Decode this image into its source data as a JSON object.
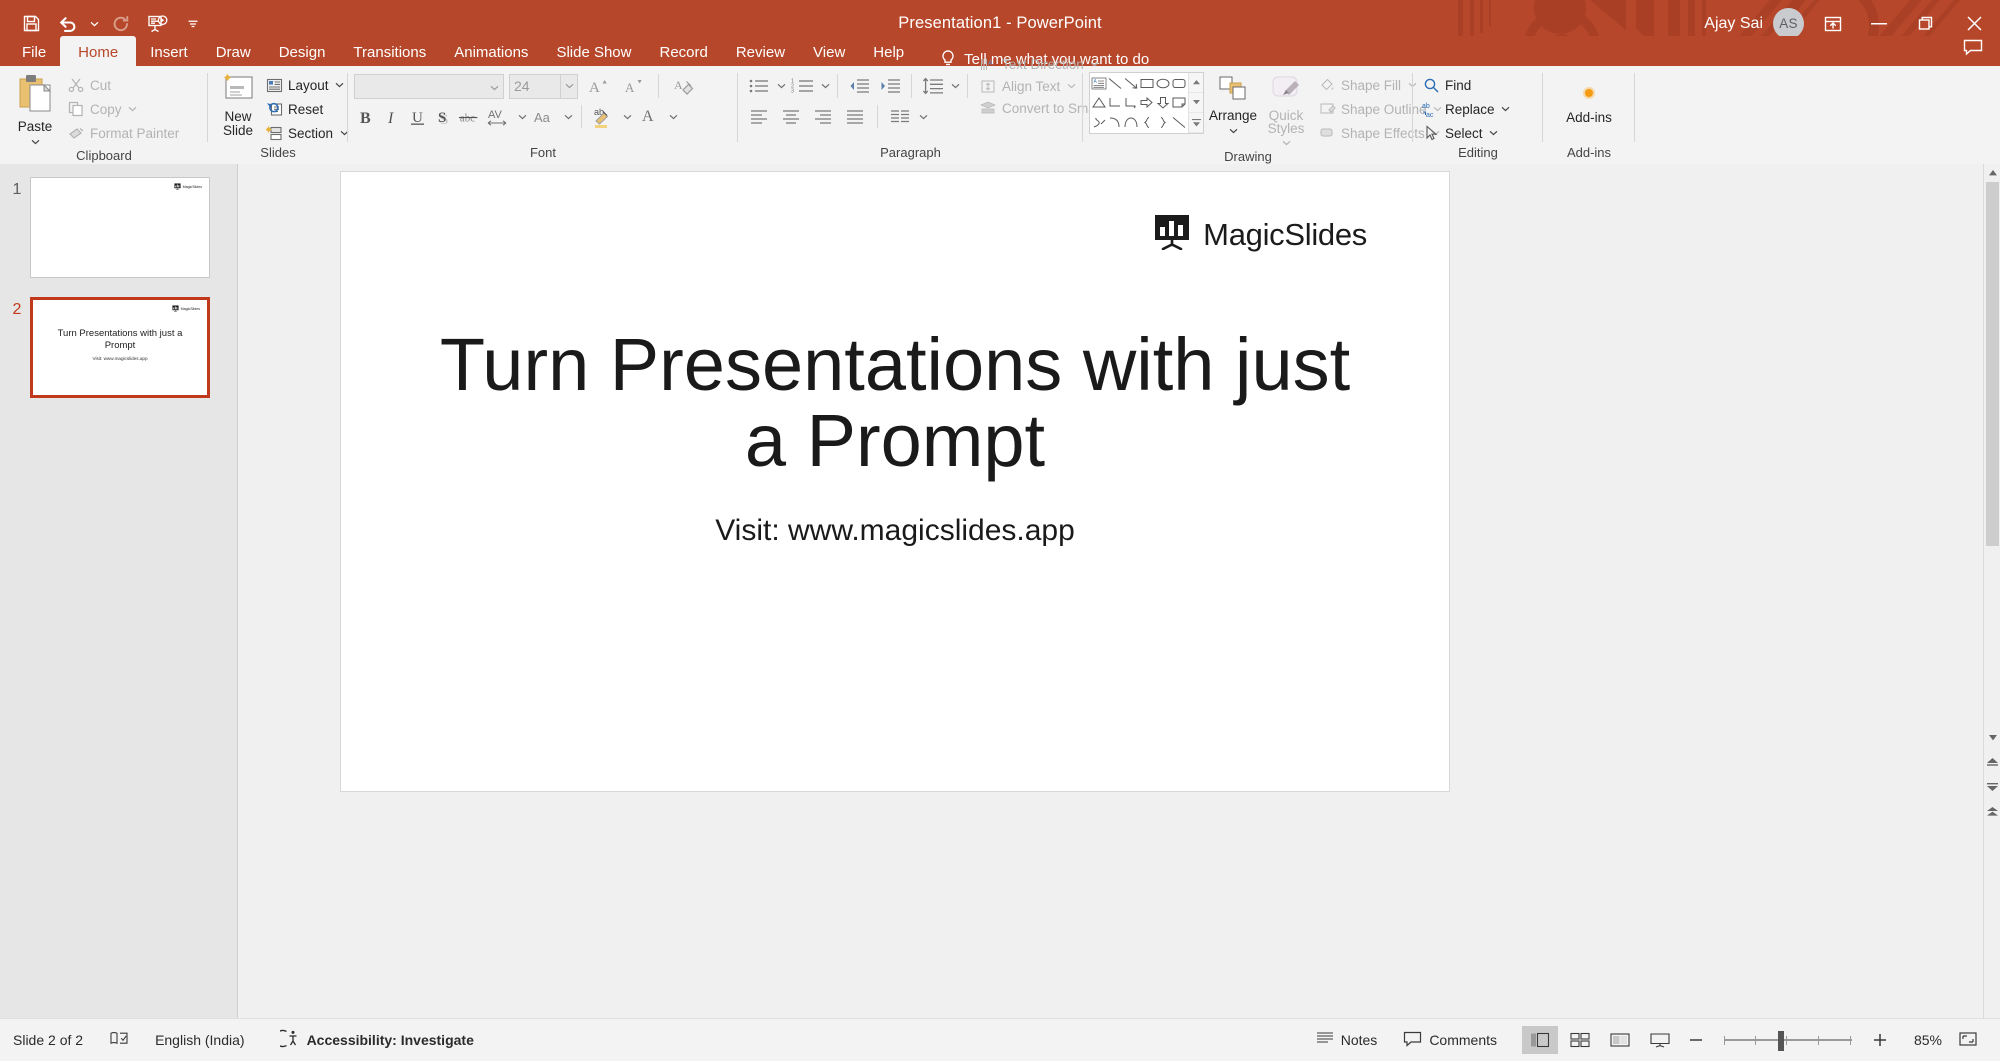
{
  "window": {
    "title": "Presentation1  -  PowerPoint",
    "account_name": "Ajay Sai",
    "account_initials": "AS",
    "accent_color": "#b7472a",
    "minimize_label": "Minimize",
    "restore_label": "Restore Down",
    "close_label": "Close",
    "ribbon_display_label": "Ribbon Display Options",
    "comments_icon_label": "comment-icon"
  },
  "quick_access": [
    {
      "name": "save-button",
      "icon": "save-icon"
    },
    {
      "name": "undo-button",
      "icon": "undo-icon"
    },
    {
      "name": "undo-dropdown",
      "icon": "chevron-down-icon"
    },
    {
      "name": "redo-button",
      "icon": "redo-icon"
    },
    {
      "name": "start-from-beginning-button",
      "icon": "slideshow-icon"
    },
    {
      "name": "customize-quick-access-toolbar",
      "icon": "more-caret-icon"
    }
  ],
  "tabs": [
    {
      "label": "File",
      "active": false
    },
    {
      "label": "Home",
      "active": true
    },
    {
      "label": "Insert",
      "active": false
    },
    {
      "label": "Draw",
      "active": false
    },
    {
      "label": "Design",
      "active": false
    },
    {
      "label": "Transitions",
      "active": false
    },
    {
      "label": "Animations",
      "active": false
    },
    {
      "label": "Slide Show",
      "active": false
    },
    {
      "label": "Record",
      "active": false
    },
    {
      "label": "Review",
      "active": false
    },
    {
      "label": "View",
      "active": false
    },
    {
      "label": "Help",
      "active": false
    }
  ],
  "tell_me": {
    "label": "Tell me what you want to do",
    "icon": "lightbulb-icon"
  },
  "ribbon": {
    "clipboard": {
      "label": "Clipboard",
      "paste": "Paste",
      "cut": "Cut",
      "copy": "Copy",
      "format_painter": "Format Painter"
    },
    "slides": {
      "label": "Slides",
      "new_slide": "New Slide",
      "layout": "Layout",
      "reset": "Reset",
      "section": "Section"
    },
    "font": {
      "label": "Font",
      "font_name": "",
      "font_name_placeholder": "",
      "font_size": "24",
      "increase_font": "Increase Font Size",
      "decrease_font": "Decrease Font Size",
      "clear_formatting": "Clear All Formatting",
      "bold": "B",
      "italic": "I",
      "underline": "U",
      "shadow": "S",
      "strikethrough": "abc",
      "character_spacing": "AV",
      "change_case": "Aa",
      "text_highlight": "Text Highlight Color",
      "font_color": "A"
    },
    "paragraph": {
      "label": "Paragraph",
      "bullets": "Bullets",
      "numbering": "Numbering",
      "decrease_indent": "Decrease List Level",
      "increase_indent": "Increase List Level",
      "line_spacing": "Line Spacing",
      "text_direction": "Text Direction",
      "align_text": "Align Text",
      "convert_to_smartart": "Convert to SmartArt",
      "align_left": "Align Left",
      "center": "Center",
      "align_right": "Align Right",
      "justify": "Justify",
      "columns": "Columns"
    },
    "drawing": {
      "label": "Drawing",
      "arrange": "Arrange",
      "quick_styles": "Quick Styles",
      "shape_fill": "Shape Fill",
      "shape_outline": "Shape Outline",
      "shape_effects": "Shape Effects"
    },
    "editing": {
      "label": "Editing",
      "find": "Find",
      "replace": "Replace",
      "select": "Select"
    },
    "addins": {
      "label": "Add-ins",
      "button": "Add-ins"
    }
  },
  "slide_panel": {
    "slides": [
      {
        "number": "1",
        "selected": false,
        "logo_text": "MagicSlides",
        "title": "",
        "subtitle": ""
      },
      {
        "number": "2",
        "selected": true,
        "logo_text": "MagicSlides",
        "title": "Turn Presentations with just a Prompt",
        "subtitle": "Visit: www.magicslides.app"
      }
    ]
  },
  "slide": {
    "logo_text": "MagicSlides",
    "title": "Turn Presentations with just a Prompt",
    "subtitle": "Visit: www.magicslides.app"
  },
  "status_bar": {
    "slide_counter": "Slide 2 of 2",
    "spellcheck_icon": "spellcheck-icon",
    "language": "English (India)",
    "accessibility": "Accessibility: Investigate",
    "notes": "Notes",
    "comments": "Comments",
    "zoom_value": "85%",
    "zoom_out_label": "Zoom Out",
    "zoom_in_label": "Zoom In",
    "fit_slide_label": "Fit slide to current window",
    "views": [
      {
        "name": "normal-view-button",
        "label": "Normal",
        "active": true
      },
      {
        "name": "slide-sorter-view-button",
        "label": "Slide Sorter",
        "active": false
      },
      {
        "name": "reading-view-button",
        "label": "Reading View",
        "active": false
      },
      {
        "name": "slide-show-view-button",
        "label": "Slide Show",
        "active": false
      }
    ]
  }
}
